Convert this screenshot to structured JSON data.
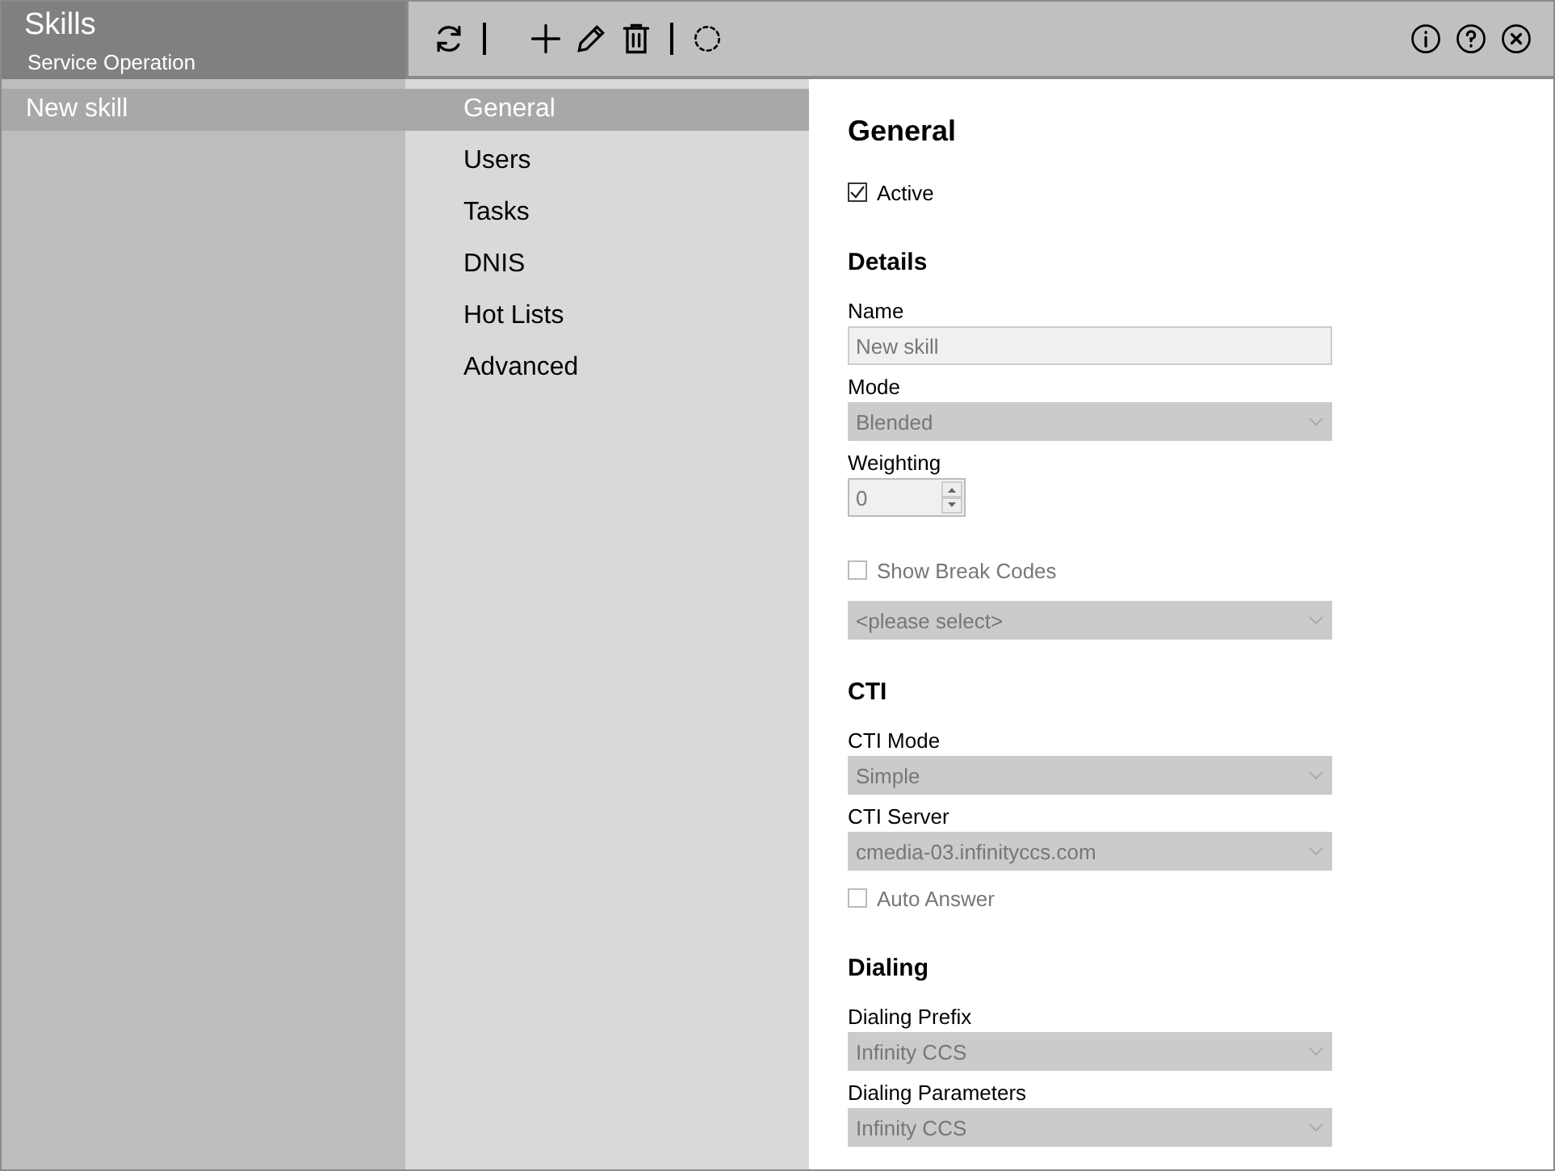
{
  "header": {
    "title": "Skills",
    "subtitle": "Service Operation"
  },
  "records": [
    {
      "label": "New skill",
      "selected": true
    }
  ],
  "nav": [
    {
      "label": "General",
      "selected": true
    },
    {
      "label": "Users",
      "selected": false
    },
    {
      "label": "Tasks",
      "selected": false
    },
    {
      "label": "DNIS",
      "selected": false
    },
    {
      "label": "Hot Lists",
      "selected": false
    },
    {
      "label": "Advanced",
      "selected": false
    }
  ],
  "form": {
    "title": "General",
    "items": [
      {
        "kind": "checkbox",
        "label": "Active",
        "checked": true,
        "disabled": false
      },
      {
        "kind": "heading",
        "label": "Details"
      },
      {
        "kind": "label",
        "label": "Name"
      },
      {
        "kind": "text",
        "value": "New skill",
        "disabled": true
      },
      {
        "kind": "label",
        "label": "Mode"
      },
      {
        "kind": "select",
        "value": "Blended",
        "disabled": true
      },
      {
        "kind": "label",
        "label": "Weighting"
      },
      {
        "kind": "spinner",
        "value": "0",
        "disabled": true
      },
      {
        "kind": "checkbox",
        "label": "Show Break Codes",
        "checked": false,
        "disabled": true
      },
      {
        "kind": "select",
        "value": "<please select>",
        "disabled": true
      },
      {
        "kind": "heading",
        "label": "CTI"
      },
      {
        "kind": "label",
        "label": "CTI Mode"
      },
      {
        "kind": "select",
        "value": "Simple",
        "disabled": true
      },
      {
        "kind": "label",
        "label": "CTI Server"
      },
      {
        "kind": "select",
        "value": "cmedia-03.infinityccs.com",
        "disabled": true
      },
      {
        "kind": "checkbox",
        "label": "Auto Answer",
        "checked": false,
        "disabled": true
      },
      {
        "kind": "heading",
        "label": "Dialing"
      },
      {
        "kind": "label",
        "label": "Dialing Prefix"
      },
      {
        "kind": "select",
        "value": "Infinity CCS",
        "disabled": true
      },
      {
        "kind": "label",
        "label": "Dialing Parameters"
      },
      {
        "kind": "select",
        "value": "Infinity CCS",
        "disabled": true
      }
    ]
  }
}
